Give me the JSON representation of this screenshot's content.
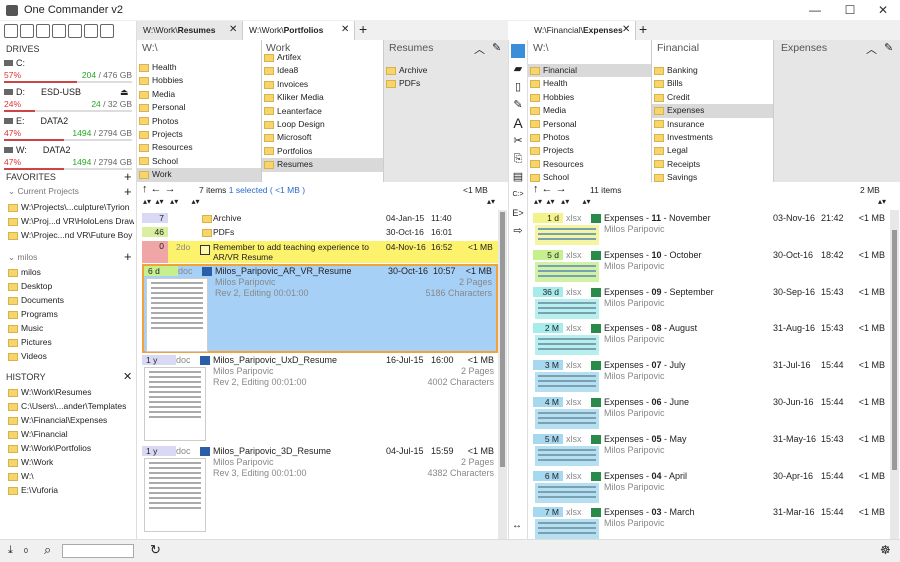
{
  "window": {
    "title": "One Commander v2",
    "minimize": "—",
    "maximize": "☐",
    "close": "✕"
  },
  "left": {
    "drives_header": "DRIVES",
    "drives": [
      {
        "letter": "C:",
        "label": "",
        "pct": "57%",
        "free": "204",
        "total": "/ 476 GB",
        "fill": 0.57
      },
      {
        "letter": "D:",
        "label": "ESD-USB",
        "pct": "24%",
        "free": "24",
        "total": "/ 32 GB",
        "fill": 0.24
      },
      {
        "letter": "E:",
        "label": "DATA2",
        "pct": "47%",
        "free": "1494",
        "total": "/ 2794 GB",
        "fill": 0.47
      },
      {
        "letter": "W:",
        "label": "DATA2",
        "pct": "47%",
        "free": "1494",
        "total": "/ 2794 GB",
        "fill": 0.47
      }
    ],
    "favorites_header": "FAVORITES",
    "current_projects": "Current Projects",
    "projects": [
      "W:\\Projects\\...culpture\\Tyrion",
      "W:\\Proj...d VR\\HoloLens Draw",
      "W:\\Projec...nd VR\\Future Boy"
    ],
    "user": "milos",
    "user_items": [
      "milos",
      "Desktop",
      "Documents",
      "Programs",
      "Music",
      "Pictures",
      "Videos"
    ],
    "history_header": "HISTORY",
    "history": [
      "W:\\Work\\Resumes",
      "C:\\Users\\...ander\\Templates",
      "W:\\Financial\\Expenses",
      "W:\\Financial",
      "W:\\Work\\Portfolios",
      "W:\\Work",
      "W:\\",
      "E:\\Vuforia"
    ]
  },
  "pane1": {
    "tabs": [
      {
        "path": "W:\\Work\\",
        "bold": "Resumes"
      },
      {
        "path": "W:\\Work\\",
        "bold": "Portfolios"
      }
    ],
    "add_tab": "+",
    "col1_header": "W:\\",
    "col1": [
      "Health",
      "Hobbies",
      "Media",
      "Personal",
      "Photos",
      "Projects",
      "Resources",
      "School",
      "Work"
    ],
    "col2_header": "Work",
    "col2": [
      "Artifex",
      "Idea8",
      "Invoices",
      "Kliker Media",
      "Leanterface",
      "Loop Design",
      "Microsoft",
      "Portfolios",
      "Resumes"
    ],
    "col3_header": "Resumes",
    "col3": [
      "Archive",
      "PDFs"
    ],
    "count": "7 items",
    "selected": "1 selected ( <1 MB )",
    "size": "<1 MB",
    "folders": [
      {
        "age": "7",
        "name": "Archive",
        "date": "04-Jan-15",
        "time": "11:40"
      },
      {
        "age": "46",
        "name": "PDFs",
        "date": "30-Oct-16",
        "time": "16:01"
      }
    ],
    "todo": {
      "age": "0",
      "tag": "2do",
      "text": "Remember to add teaching experience to AR/VR Resume",
      "date": "04-Nov-16",
      "time": "16:52",
      "size": "<1 MB"
    },
    "docs": [
      {
        "age": "6 d",
        "ext": "doc",
        "name": "Milos_Paripovic_AR_VR_Resume",
        "author": "Milos Paripovic",
        "rev": "Rev 2, Editing 00:01:00",
        "date": "30-Oct-16",
        "time": "10:57",
        "size": "<1 MB",
        "pages": "2 Pages",
        "chars": "5186 Characters"
      },
      {
        "age": "1 y",
        "ext": "doc",
        "name": "Milos_Paripovic_UxD_Resume",
        "author": "Milos Paripovic",
        "rev": "Rev 2, Editing 00:01:00",
        "date": "16-Jul-15",
        "time": "16:00",
        "size": "<1 MB",
        "pages": "2 Pages",
        "chars": "4002 Characters"
      },
      {
        "age": "1 y",
        "ext": "doc",
        "name": "Milos_Paripovic_3D_Resume",
        "author": "Milos Paripovic",
        "rev": "Rev 3, Editing 00:01:00",
        "date": "04-Jul-15",
        "time": "15:59",
        "size": "<1 MB",
        "pages": "2 Pages",
        "chars": "4382 Characters"
      }
    ]
  },
  "pane2": {
    "tabs": [
      {
        "path": "W:\\Financial\\",
        "bold": "Expenses"
      }
    ],
    "add_tab": "+",
    "col1_header": "W:\\",
    "col1": [
      "Financial",
      "Health",
      "Hobbies",
      "Media",
      "Personal",
      "Photos",
      "Projects",
      "Resources",
      "School"
    ],
    "col2_header": "Financial",
    "col2": [
      "Banking",
      "Bills",
      "Credit",
      "Expenses",
      "Insurance",
      "Investments",
      "Legal",
      "Receipts",
      "Savings"
    ],
    "col3_header": "Expenses",
    "count": "11 items",
    "size": "2 MB",
    "files": [
      {
        "age": "1 d",
        "ext": "xlsx",
        "name": "Expenses - ",
        "num": "11",
        "month": " - November",
        "author": "Milos Paripovic",
        "date": "03-Nov-16",
        "time": "21:42",
        "size": "<1 MB",
        "color": "#f3f38a"
      },
      {
        "age": "5 d",
        "ext": "xlsx",
        "name": "Expenses - ",
        "num": "10",
        "month": " - October",
        "author": "Milos Paripovic",
        "date": "30-Oct-16",
        "time": "18:42",
        "size": "<1 MB",
        "color": "#c6ef8e"
      },
      {
        "age": "36 d",
        "ext": "xlsx",
        "name": "Expenses - ",
        "num": "09",
        "month": " - September",
        "author": "Milos Paripovic",
        "date": "30-Sep-16",
        "time": "15:43",
        "size": "<1 MB",
        "color": "#a6ecec"
      },
      {
        "age": "2 M",
        "ext": "xlsx",
        "name": "Expenses - ",
        "num": "08",
        "month": " - August",
        "author": "Milos Paripovic",
        "date": "31-Aug-16",
        "time": "15:43",
        "size": "<1 MB",
        "color": "#a6ecec"
      },
      {
        "age": "3 M",
        "ext": "xlsx",
        "name": "Expenses - ",
        "num": "07",
        "month": " - July",
        "author": "Milos Paripovic",
        "date": "31-Jul-16",
        "time": "15:44",
        "size": "<1 MB",
        "color": "#a6d8f0"
      },
      {
        "age": "4 M",
        "ext": "xlsx",
        "name": "Expenses - ",
        "num": "06",
        "month": " - June",
        "author": "Milos Paripovic",
        "date": "30-Jun-16",
        "time": "15:44",
        "size": "<1 MB",
        "color": "#a6d8f0"
      },
      {
        "age": "5 M",
        "ext": "xlsx",
        "name": "Expenses - ",
        "num": "05",
        "month": " - May",
        "author": "Milos Paripovic",
        "date": "31-May-16",
        "time": "15:43",
        "size": "<1 MB",
        "color": "#a6d8f0"
      },
      {
        "age": "6 M",
        "ext": "xlsx",
        "name": "Expenses - ",
        "num": "04",
        "month": " - April",
        "author": "Milos Paripovic",
        "date": "30-Apr-16",
        "time": "15:44",
        "size": "<1 MB",
        "color": "#a6d8f0"
      },
      {
        "age": "7 M",
        "ext": "xlsx",
        "name": "Expenses - ",
        "num": "03",
        "month": " - March",
        "author": "Milos Paripovic",
        "date": "31-Mar-16",
        "time": "15:44",
        "size": "<1 MB",
        "color": "#a6d8f0"
      }
    ]
  },
  "status": {
    "count": "0"
  }
}
